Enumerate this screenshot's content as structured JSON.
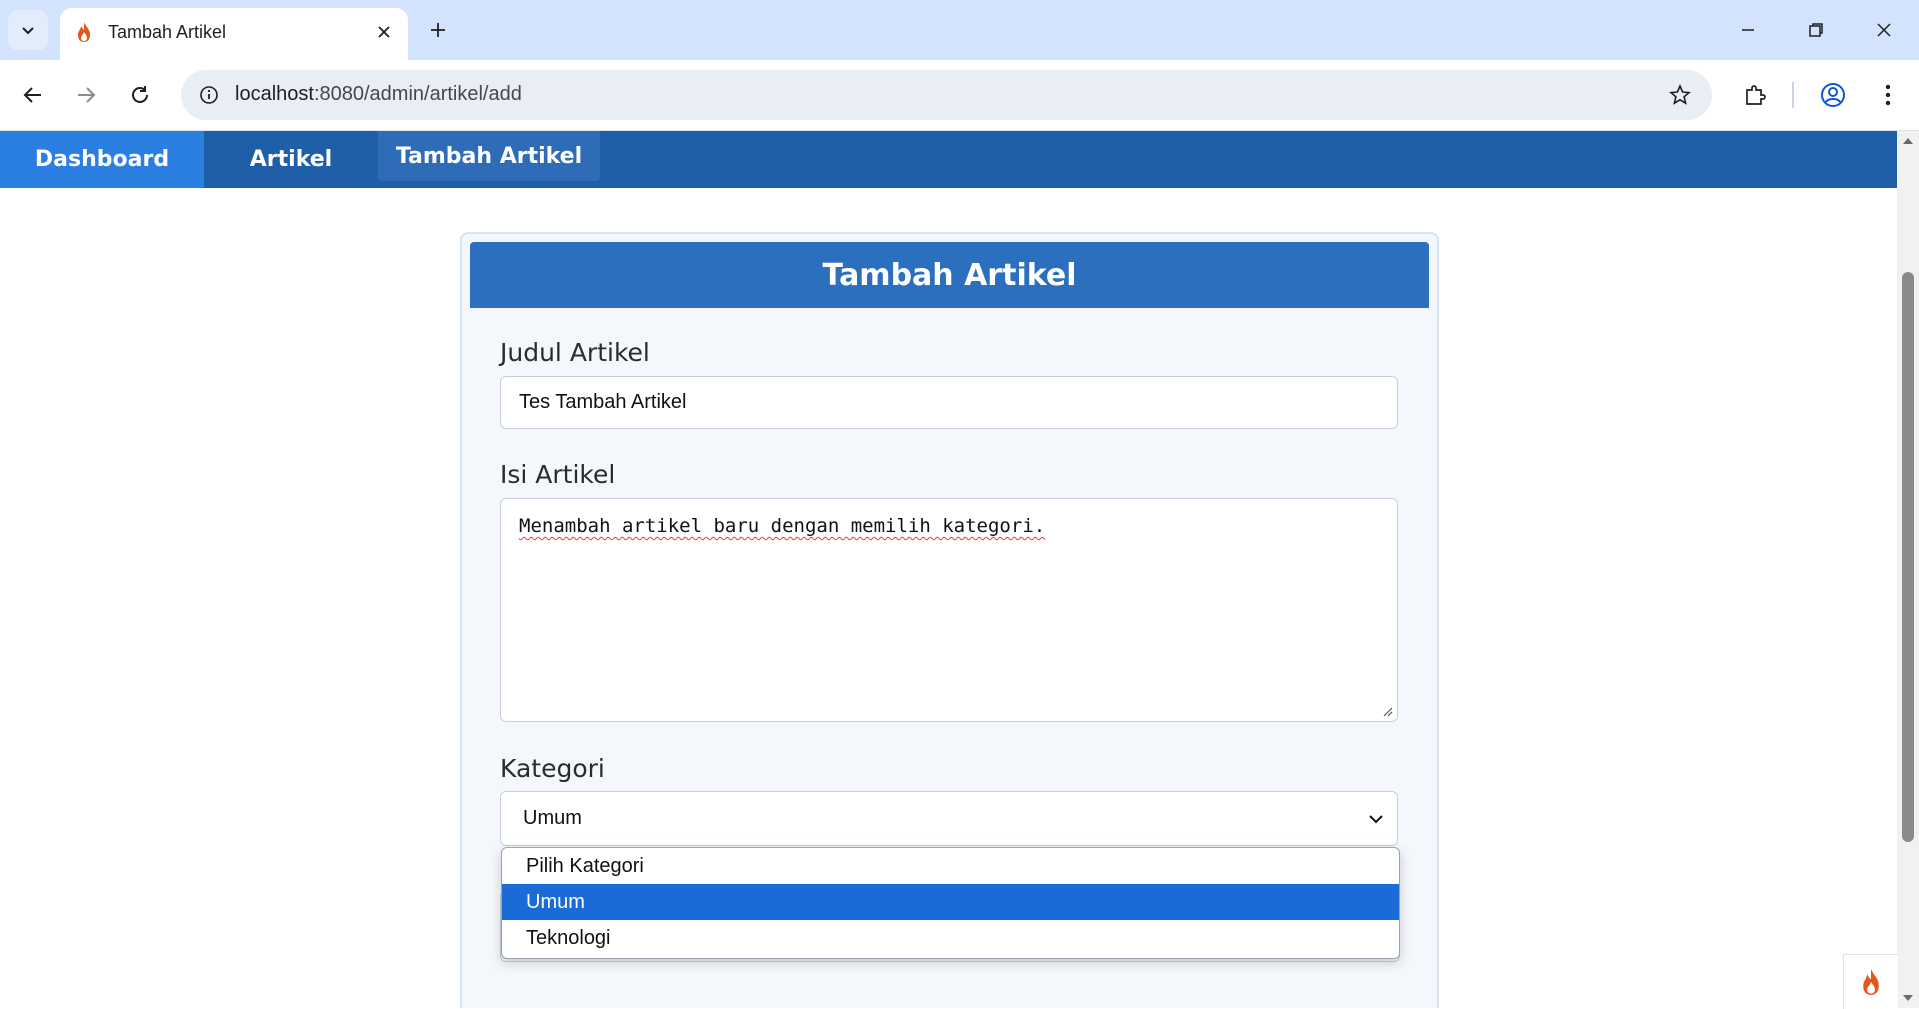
{
  "browser": {
    "tab_title": "Tambah Artikel",
    "url_host": "localhost",
    "url_path": ":8080/admin/artikel/add"
  },
  "icons": {
    "tab_favicon": "flame-icon",
    "back": "arrow-left-icon",
    "forward": "arrow-right-icon",
    "reload": "reload-icon",
    "info": "info-icon",
    "star": "star-icon",
    "extensions": "puzzle-icon",
    "profile": "profile-icon",
    "menu": "kebab-menu-icon"
  },
  "nav": {
    "items": [
      {
        "label": "Dashboard"
      },
      {
        "label": "Artikel"
      },
      {
        "label": "Tambah Artikel"
      }
    ]
  },
  "form": {
    "header": "Tambah Artikel",
    "title_label": "Judul Artikel",
    "title_value": "Tes Tambah Artikel",
    "content_label": "Isi Artikel",
    "content_value": "Menambah artikel baru dengan memilih kategori.",
    "category_label": "Kategori",
    "category_value": "Umum",
    "category_options": [
      "Pilih Kategori",
      "Umum",
      "Teknologi"
    ],
    "category_selected_index": 1
  },
  "colors": {
    "nav_bg": "#1e5fa8",
    "nav_active": "#2a7fe0",
    "header_bg": "#2b6fbe",
    "option_selected": "#1a6bd6"
  }
}
